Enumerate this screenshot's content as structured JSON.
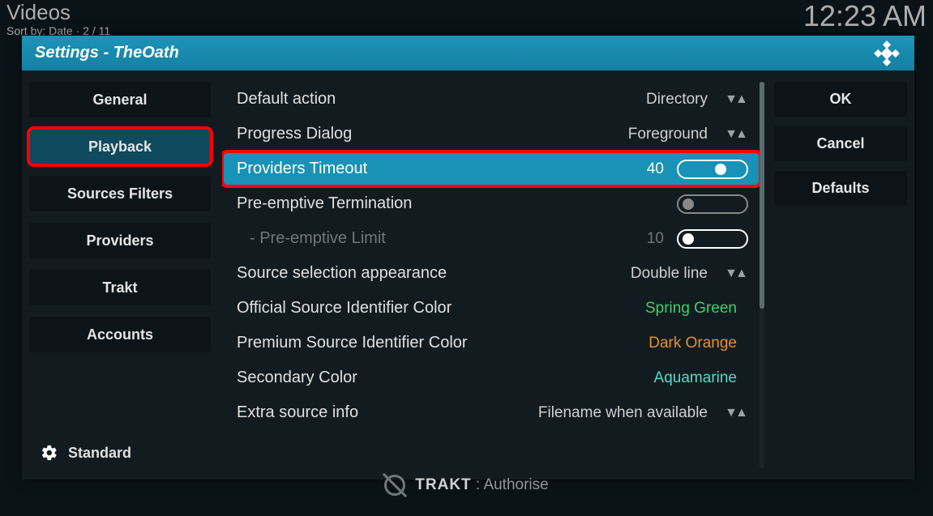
{
  "top": {
    "title": "Videos",
    "sortline": "Sort by: Date  ·  2 / 11",
    "time": "12:23 AM"
  },
  "dialog": {
    "title": "Settings - TheOath"
  },
  "sidebar": {
    "items": [
      "General",
      "Playback",
      "Sources Filters",
      "Providers",
      "Trakt",
      "Accounts"
    ],
    "active_index": 1,
    "level_label": "Standard"
  },
  "right": {
    "ok": "OK",
    "cancel": "Cancel",
    "defaults": "Defaults"
  },
  "settings": [
    {
      "label": "Default action",
      "value": "Directory",
      "type": "spinner"
    },
    {
      "label": "Progress Dialog",
      "value": "Foreground",
      "type": "spinner"
    },
    {
      "label": "Providers Timeout",
      "value": "40",
      "type": "slider",
      "selected": true
    },
    {
      "label": "Pre-emptive Termination",
      "type": "toggle",
      "on": false
    },
    {
      "label": "- Pre-emptive Limit",
      "value": "10",
      "type": "slider_off",
      "disabled": true,
      "indent": true
    },
    {
      "label": "Source selection appearance",
      "value": "Double line",
      "type": "spinner"
    },
    {
      "label": "Official Source Identifier Color",
      "value": "Spring Green",
      "type": "text",
      "cls": "val-green"
    },
    {
      "label": "Premium Source Identifier Color",
      "value": "Dark Orange",
      "type": "text",
      "cls": "val-orange"
    },
    {
      "label": "Secondary Color",
      "value": "Aquamarine",
      "type": "text",
      "cls": "val-aqua"
    },
    {
      "label": "Extra source info",
      "value": "Filename when available",
      "type": "spinner"
    }
  ],
  "footer": {
    "trakt_label": "TRAKT",
    "trakt_action": " : Authorise"
  }
}
